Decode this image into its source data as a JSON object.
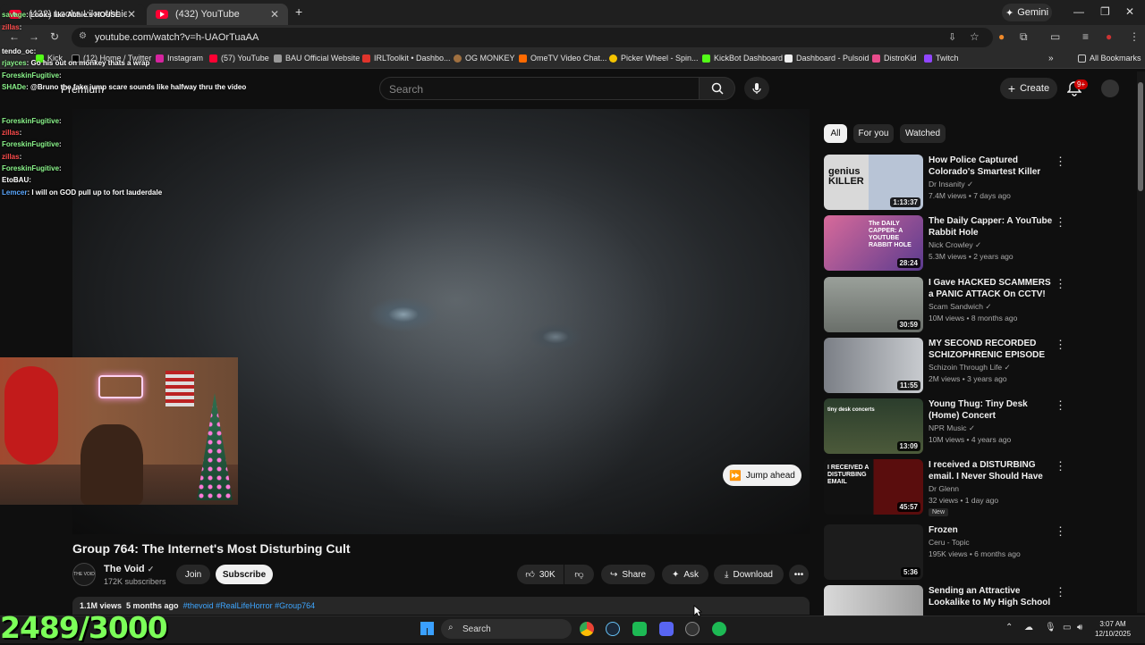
{
  "browser": {
    "tabs": [
      {
        "label": "(432) Looks Like Abhie's House",
        "active": false
      },
      {
        "label": "(432) YouTube",
        "active": true
      }
    ],
    "new_tab": "+",
    "gemini_label": "Gemini",
    "url": "youtube.com/watch?v=h-UAOrTuaAA",
    "bookmarks": [
      {
        "label": "Kick"
      },
      {
        "label": "(12) Home / Twitter"
      },
      {
        "label": "Instagram"
      },
      {
        "label": "(57) YouTube"
      },
      {
        "label": "BAU Official Website"
      },
      {
        "label": "IRLToolkit • Dashbo..."
      },
      {
        "label": "OG MONKEY"
      },
      {
        "label": "OmeTV Video Chat..."
      },
      {
        "label": "Picker Wheel - Spin..."
      },
      {
        "label": "KickBot Dashboard"
      },
      {
        "label": "Dashboard - Pulsoid"
      },
      {
        "label": "DistroKid"
      },
      {
        "label": "Twitch"
      }
    ],
    "all_bookmarks": "All Bookmarks"
  },
  "youtube": {
    "logo_text": "Premium",
    "search_placeholder": "Search",
    "create_label": "Create",
    "notif_badge": "9+",
    "jump_ahead": "Jump ahead",
    "video": {
      "title": "Group 764: The Internet's Most Disturbing Cult",
      "channel": "The Void",
      "channel_avatar": "THE VOID",
      "subscribers": "172K subscribers",
      "join": "Join",
      "subscribe": "Subscribe",
      "likes": "30K",
      "share": "Share",
      "ask": "Ask",
      "download": "Download",
      "views": "1.1M views",
      "age": "5 months ago",
      "tags": "#thevoid #RealLifeHorror #Group764"
    },
    "chips": [
      "All",
      "For you",
      "Watched"
    ],
    "recommendations": [
      {
        "title": "How Police Captured Colorado's Smartest Killer",
        "channel": "Dr Insanity",
        "views": "7.4M views",
        "age": "7 days ago",
        "duration": "1:13:37",
        "thumb_text": "genius KILLER"
      },
      {
        "title": "The Daily Capper: A YouTube Rabbit Hole",
        "channel": "Nick Crowley",
        "views": "5.3M views",
        "age": "2 years ago",
        "duration": "28:24",
        "thumb_text": "The DAILY CAPPER: A YOUTUBE RABBIT HOLE"
      },
      {
        "title": "I Gave HACKED SCAMMERS a PANIC ATTACK On CCTV!",
        "channel": "Scam Sandwich",
        "views": "10M views",
        "age": "8 months ago",
        "duration": "30:59"
      },
      {
        "title": "MY SECOND RECORDED SCHIZOPHRENIC EPISODE",
        "channel": "Schizoin Through Life",
        "views": "2M views",
        "age": "3 years ago",
        "duration": "11:55"
      },
      {
        "title": "Young Thug: Tiny Desk (Home) Concert",
        "channel": "NPR Music",
        "views": "10M views",
        "age": "4 years ago",
        "duration": "13:09",
        "thumb_text": "tiny desk concerts"
      },
      {
        "title": "I received a DISTURBING email. I Never Should Have Opened It...",
        "channel": "Dr Glenn",
        "views": "32 views",
        "age": "1 day ago",
        "duration": "45:57",
        "badge": "New",
        "thumb_text": "I RECEIVED A DISTURBING EMAIL"
      },
      {
        "title": "Frozen",
        "channel": "Ceru - Topic",
        "views": "195K views",
        "age": "6 months ago",
        "duration": "5:36"
      },
      {
        "title": "Sending an Attractive Lookalike to My High School Reunion",
        "channel": "",
        "views": "",
        "age": "",
        "duration": ""
      }
    ]
  },
  "overlay": {
    "chat": [
      {
        "user": "savage",
        "msg": "Looks like Abhie's HOUSE"
      },
      {
        "user": "zillas",
        "msg": ""
      },
      {
        "user": "tendo_oc",
        "msg": ""
      },
      {
        "user": "rjayces",
        "msg": "Go his out on monkey thats a wrap"
      },
      {
        "user": "ForeskinFugitive",
        "msg": ""
      },
      {
        "user": "SHADe",
        "msg": "@Bruno the fake jump scare sounds like halfway thru the video"
      },
      {
        "user": "ForeskinFugitive",
        "msg": ""
      },
      {
        "user": "zillas",
        "msg": ""
      },
      {
        "user": "ForeskinFugitive",
        "msg": ""
      },
      {
        "user": "zillas",
        "msg": ""
      },
      {
        "user": "ForeskinFugitive",
        "msg": ""
      },
      {
        "user": "EtoBAU",
        "msg": ""
      },
      {
        "user": "Lemcer",
        "msg": "I will on GOD pull up to fort lauderdale"
      }
    ],
    "counter": "2489/3000"
  },
  "taskbar": {
    "search_label": "Search",
    "time": "3:07 AM",
    "date": "12/10/2025"
  },
  "colors": {
    "accent_red": "#ff0033",
    "counter_green": "#7CFF59",
    "link_blue": "#3ea6ff"
  }
}
